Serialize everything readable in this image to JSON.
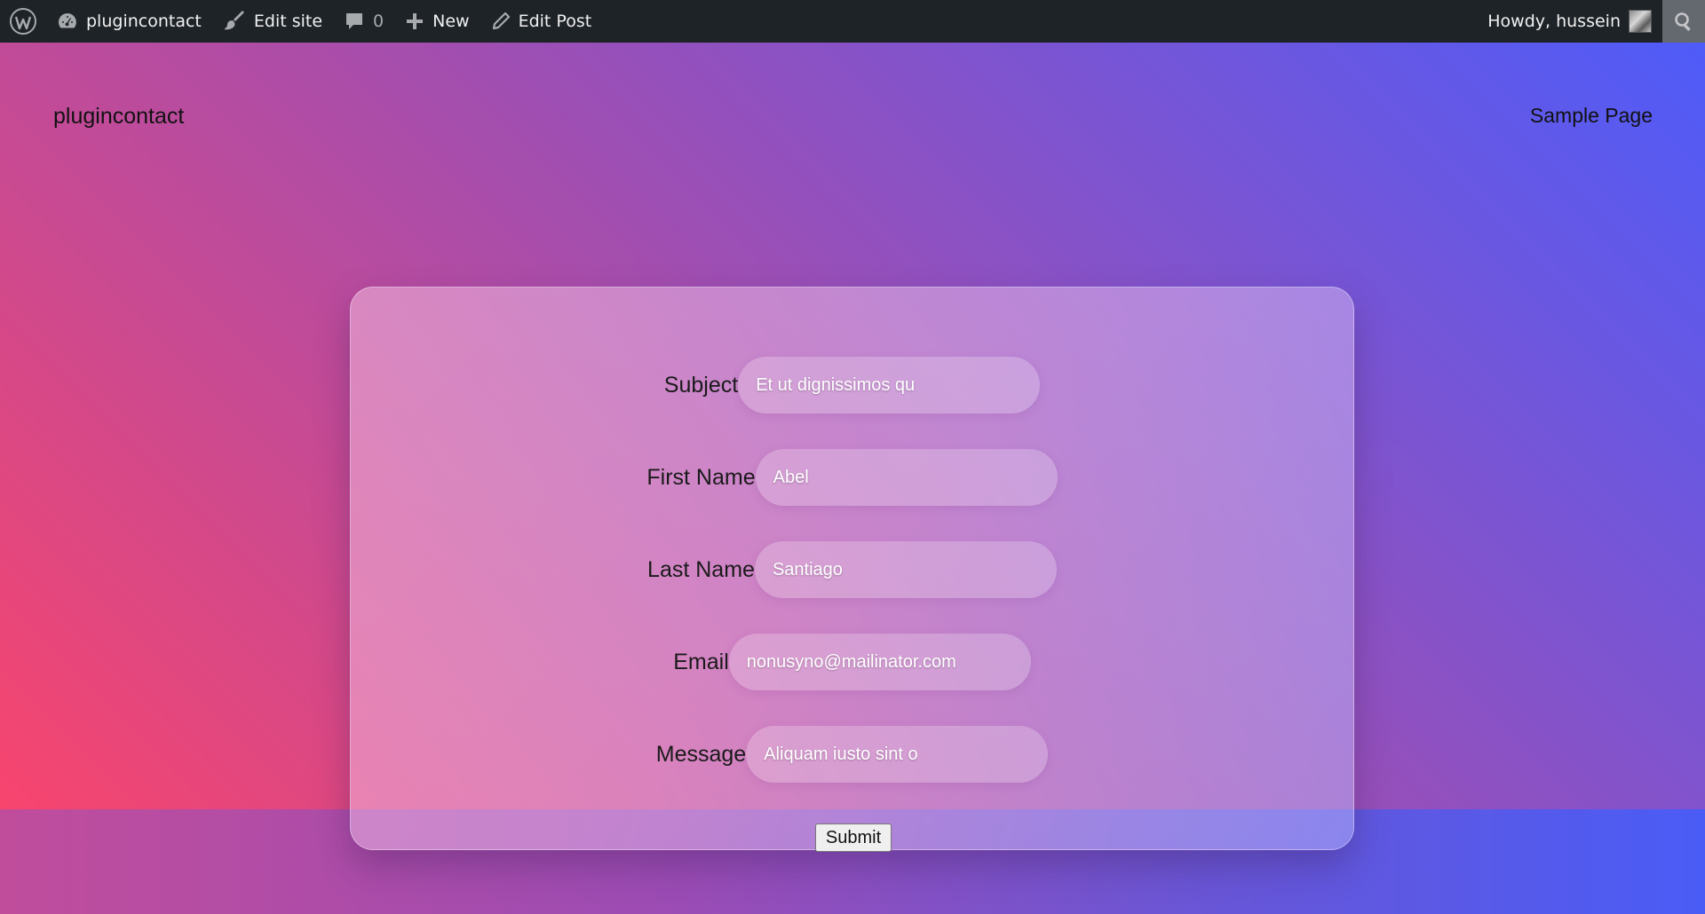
{
  "admin_bar": {
    "site_name": "plugincontact",
    "edit_site": "Edit site",
    "comments_count": "0",
    "new_label": "New",
    "edit_post": "Edit Post",
    "howdy": "Howdy, hussein"
  },
  "header": {
    "site_title": "plugincontact",
    "nav_sample_page": "Sample Page"
  },
  "form": {
    "fields": [
      {
        "label": "Subject",
        "value": "Et ut dignissimos qu"
      },
      {
        "label": "First Name",
        "value": "Abel"
      },
      {
        "label": "Last Name",
        "value": "Santiago"
      },
      {
        "label": "Email",
        "value": "nonusyno@mailinator.com"
      },
      {
        "label": "Message",
        "value": "Aliquam iusto sint o"
      }
    ],
    "submit_label": "Submit"
  },
  "colors": {
    "gradient_start": "#ff4468",
    "gradient_mid": "#a24eb0",
    "gradient_end": "#4c5cfb",
    "admin_bar_bg": "#1e2327"
  },
  "icons": {
    "wordpress": "wordpress-logo-icon",
    "dashboard": "dashboard-icon",
    "edit_site": "brush-icon",
    "comments": "comment-bubble-icon",
    "new": "plus-icon",
    "edit_post": "pencil-icon",
    "search": "search-icon"
  }
}
